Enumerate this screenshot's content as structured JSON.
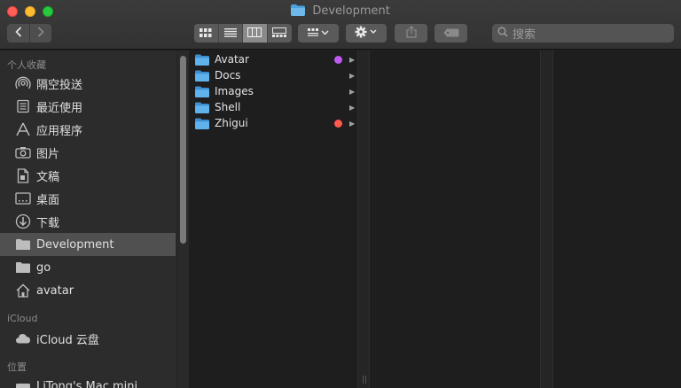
{
  "window": {
    "title": "Development"
  },
  "toolbar": {
    "search_placeholder": "搜索",
    "colors": {
      "close": "#ff5f57",
      "minimize": "#febc2e",
      "maximize": "#28c840"
    }
  },
  "sidebar": {
    "favorites_header": "个人收藏",
    "favorites": [
      {
        "label": "隔空投送",
        "icon": "airdrop-icon"
      },
      {
        "label": "最近使用",
        "icon": "recents-icon"
      },
      {
        "label": "应用程序",
        "icon": "applications-icon"
      },
      {
        "label": "图片",
        "icon": "camera-icon"
      },
      {
        "label": "文稿",
        "icon": "document-icon"
      },
      {
        "label": "桌面",
        "icon": "desktop-icon"
      },
      {
        "label": "下载",
        "icon": "download-icon"
      },
      {
        "label": "Development",
        "icon": "folder-icon",
        "selected": true
      },
      {
        "label": "go",
        "icon": "folder-icon"
      },
      {
        "label": "avatar",
        "icon": "home-icon"
      }
    ],
    "icloud_header": "iCloud",
    "icloud": [
      {
        "label": "iCloud 云盘",
        "icon": "cloud-icon"
      }
    ],
    "locations_header": "位置",
    "locations": [
      {
        "label": "LiTong's Mac mini",
        "icon": "computer-icon"
      }
    ]
  },
  "column1": {
    "items": [
      {
        "label": "Avatar",
        "tag_color": "#bf5af2"
      },
      {
        "label": "Docs",
        "tag_color": null
      },
      {
        "label": "Images",
        "tag_color": null
      },
      {
        "label": "Shell",
        "tag_color": null
      },
      {
        "label": "Zhigui",
        "tag_color": "#ff5a4e"
      }
    ]
  },
  "colors": {
    "folder": "#4aa3df",
    "selected_row": "#505050"
  }
}
